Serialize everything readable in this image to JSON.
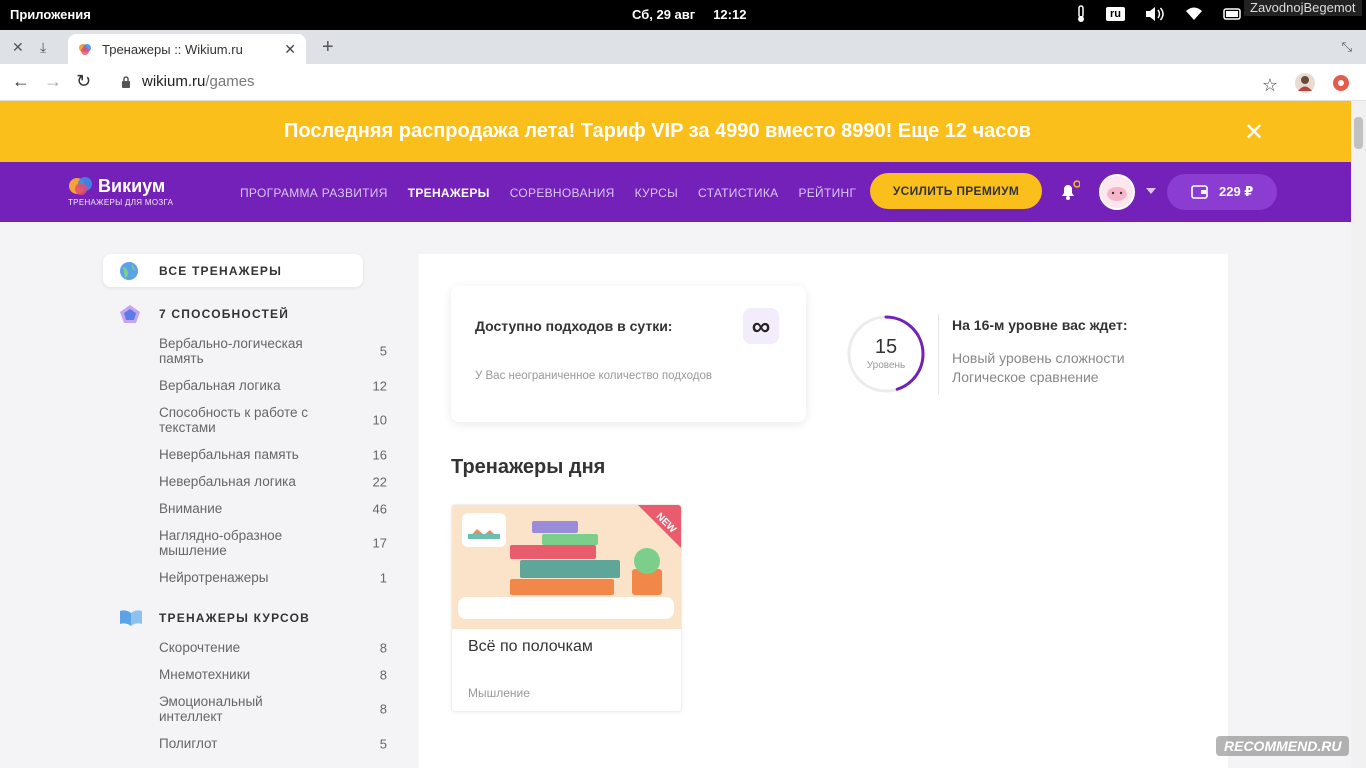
{
  "os": {
    "apps_label": "Приложения",
    "date": "Сб, 29 авг",
    "time": "12:12",
    "lang": "ru",
    "user": "ZavodnojBegemot"
  },
  "browser": {
    "tab_title": "Тренажеры :: Wikium.ru",
    "url_host": "wikium.ru",
    "url_path": "/games"
  },
  "promo": {
    "text": "Последняя распродажа лета! Тариф VIP за 4990 вместо 8990! Еще 12 часов",
    "close": "✕"
  },
  "header": {
    "logo_name": "Викиум",
    "logo_sub": "ТРЕНАЖЕРЫ ДЛЯ МОЗГА",
    "nav": [
      {
        "label": "ПРОГРАММА РАЗВИТИЯ"
      },
      {
        "label": "ТРЕНАЖЕРЫ"
      },
      {
        "label": "СОРЕВНОВАНИЯ"
      },
      {
        "label": "КУРСЫ"
      },
      {
        "label": "СТАТИСТИКА"
      },
      {
        "label": "РЕЙТИНГ"
      }
    ],
    "premium_btn": "УСИЛИТЬ ПРЕМИУМ",
    "balance": "229 ₽",
    "accent": "#7321b8",
    "yellow": "#fbbf1c"
  },
  "sidebar": {
    "all": "ВСЕ ТРЕНАЖЕРЫ",
    "abilities_title": "7 СПОСОБНОСТЕЙ",
    "abilities": [
      {
        "label": "Вербально-логическая память",
        "count": "5"
      },
      {
        "label": "Вербальная логика",
        "count": "12"
      },
      {
        "label": "Способность к работе с текстами",
        "count": "10"
      },
      {
        "label": "Невербальная память",
        "count": "16"
      },
      {
        "label": "Невербальная логика",
        "count": "22"
      },
      {
        "label": "Внимание",
        "count": "46"
      },
      {
        "label": "Наглядно-образное мышление",
        "count": "17"
      },
      {
        "label": "Нейротренажеры",
        "count": "1"
      }
    ],
    "courses_title": "ТРЕНАЖЕРЫ КУРСОВ",
    "courses": [
      {
        "label": "Скорочтение",
        "count": "8"
      },
      {
        "label": "Мнемотехники",
        "count": "8"
      },
      {
        "label": "Эмоциональный интеллект",
        "count": "8"
      },
      {
        "label": "Полиглот",
        "count": "5"
      }
    ]
  },
  "main": {
    "attempts_title": "Доступно подходов в сутки:",
    "attempts_icon": "∞",
    "attempts_sub": "У Вас неограниченное количество подходов",
    "level": "15",
    "level_label": "Уровень",
    "level_progress": 0.45,
    "next_title": "На 16-м уровне вас ждет:",
    "next_items": [
      "Новый уровень сложности",
      "Логическое сравнение"
    ],
    "section_title": "Тренажеры дня",
    "game": {
      "title": "Всё по полочкам",
      "category": "Мышление",
      "badge": "NEW"
    }
  },
  "watermark": "RECOMMEND.RU"
}
